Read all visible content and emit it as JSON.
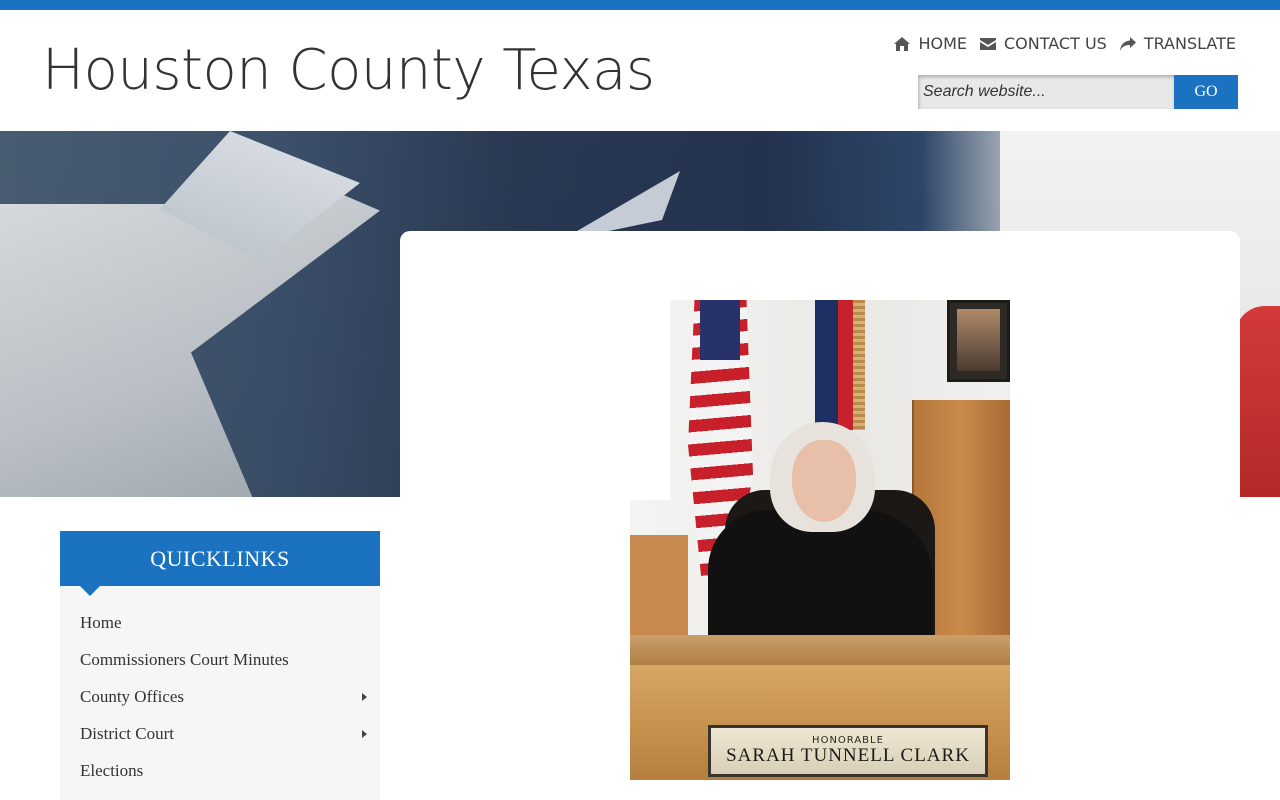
{
  "header": {
    "site_title": "Houston County Texas",
    "nav": [
      {
        "label": "HOME",
        "icon": "home-icon"
      },
      {
        "label": "CONTACT US",
        "icon": "envelope-icon"
      },
      {
        "label": "TRANSLATE",
        "icon": "share-arrow-icon"
      }
    ],
    "search": {
      "placeholder": "Search website...",
      "value": "",
      "button_label": "GO"
    }
  },
  "colors": {
    "accent": "#1a72c0",
    "background": "#ffffff",
    "sidebar_bg": "#f6f6f6",
    "text": "#333333"
  },
  "photo": {
    "nameplate_small": "HONORABLE",
    "nameplate_name": "SARAH TUNNELL CLARK"
  },
  "quicklinks": {
    "title": "QUICKLINKS",
    "items": [
      {
        "label": "Home",
        "has_submenu": false
      },
      {
        "label": "Commissioners Court Minutes",
        "has_submenu": false
      },
      {
        "label": "County Offices",
        "has_submenu": true
      },
      {
        "label": "District Court",
        "has_submenu": true
      },
      {
        "label": "Elections",
        "has_submenu": false
      }
    ]
  }
}
